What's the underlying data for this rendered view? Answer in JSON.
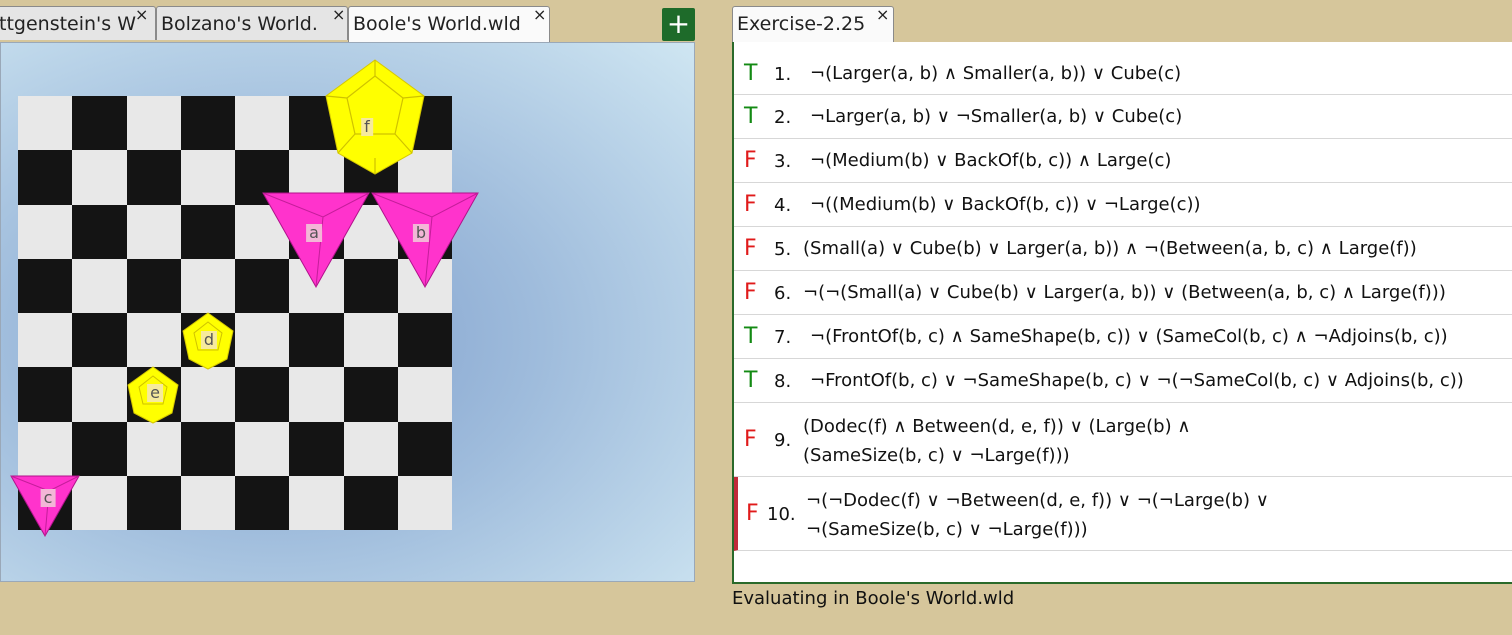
{
  "world_tabs": [
    {
      "label": "ttgenstein's W",
      "close": "×"
    },
    {
      "label": "Bolzano's World.",
      "close": "×"
    },
    {
      "label": "Boole's World.wld",
      "close": "×"
    }
  ],
  "add_button_label": "+",
  "exercise_tab": {
    "label": "Exercise-2.25",
    "close": "×"
  },
  "objects": [
    {
      "name": "f",
      "shape": "dodecahedron",
      "size": "large",
      "color": "#ffff00"
    },
    {
      "name": "a",
      "shape": "tetrahedron",
      "size": "large",
      "color": "#ff33cc"
    },
    {
      "name": "b",
      "shape": "tetrahedron",
      "size": "large",
      "color": "#ff33cc"
    },
    {
      "name": "d",
      "shape": "dodecahedron",
      "size": "small",
      "color": "#ffff00"
    },
    {
      "name": "e",
      "shape": "dodecahedron",
      "size": "small",
      "color": "#ffff00"
    },
    {
      "name": "c",
      "shape": "tetrahedron",
      "size": "medium",
      "color": "#ff33cc"
    }
  ],
  "sentences": [
    {
      "truth": "T",
      "num": "1.",
      "line1": "¬(Larger(a, b) ∧ Smaller(a, b)) ∨ Cube(c)",
      "line2": ""
    },
    {
      "truth": "T",
      "num": "2.",
      "line1": "¬Larger(a, b) ∨ ¬Smaller(a, b) ∨ Cube(c)",
      "line2": ""
    },
    {
      "truth": "F",
      "num": "3.",
      "line1": "¬(Medium(b) ∨ BackOf(b, c)) ∧ Large(c)",
      "line2": ""
    },
    {
      "truth": "F",
      "num": "4.",
      "line1": "¬((Medium(b) ∨ BackOf(b, c)) ∨ ¬Large(c))",
      "line2": ""
    },
    {
      "truth": "F",
      "num": "5.",
      "line1": "(Small(a) ∨ Cube(b) ∨ Larger(a, b)) ∧ ¬(Between(a, b, c) ∧ Large(f))",
      "line2": ""
    },
    {
      "truth": "F",
      "num": "6.",
      "line1": "¬(¬(Small(a) ∨ Cube(b) ∨ Larger(a, b)) ∨ (Between(a, b, c) ∧ Large(f)))",
      "line2": ""
    },
    {
      "truth": "T",
      "num": "7.",
      "line1": "¬(FrontOf(b, c) ∧ SameShape(b, c)) ∨ (SameCol(b, c) ∧ ¬Adjoins(b, c))",
      "line2": ""
    },
    {
      "truth": "T",
      "num": "8.",
      "line1": "¬FrontOf(b, c) ∨ ¬SameShape(b, c) ∨ ¬(¬SameCol(b, c) ∨ Adjoins(b, c))",
      "line2": ""
    },
    {
      "truth": "F",
      "num": "9.",
      "line1": "(Dodec(f) ∧ Between(d, e, f)) ∨ (Large(b) ∧",
      "line2": "(SameSize(b, c) ∨ ¬Large(f)))"
    },
    {
      "truth": "F",
      "num": "10.",
      "line1": "¬(¬Dodec(f) ∨ ¬Between(d, e, f)) ∨ ¬(¬Large(b) ∨",
      "line2": "¬(SameSize(b, c) ∨ ¬Large(f)))"
    }
  ],
  "status": "Evaluating in Boole's World.wld",
  "colors": {
    "true": "#138a13",
    "false": "#e01a1a",
    "add_button": "#1e6b2a",
    "background": "#d6c69b"
  }
}
